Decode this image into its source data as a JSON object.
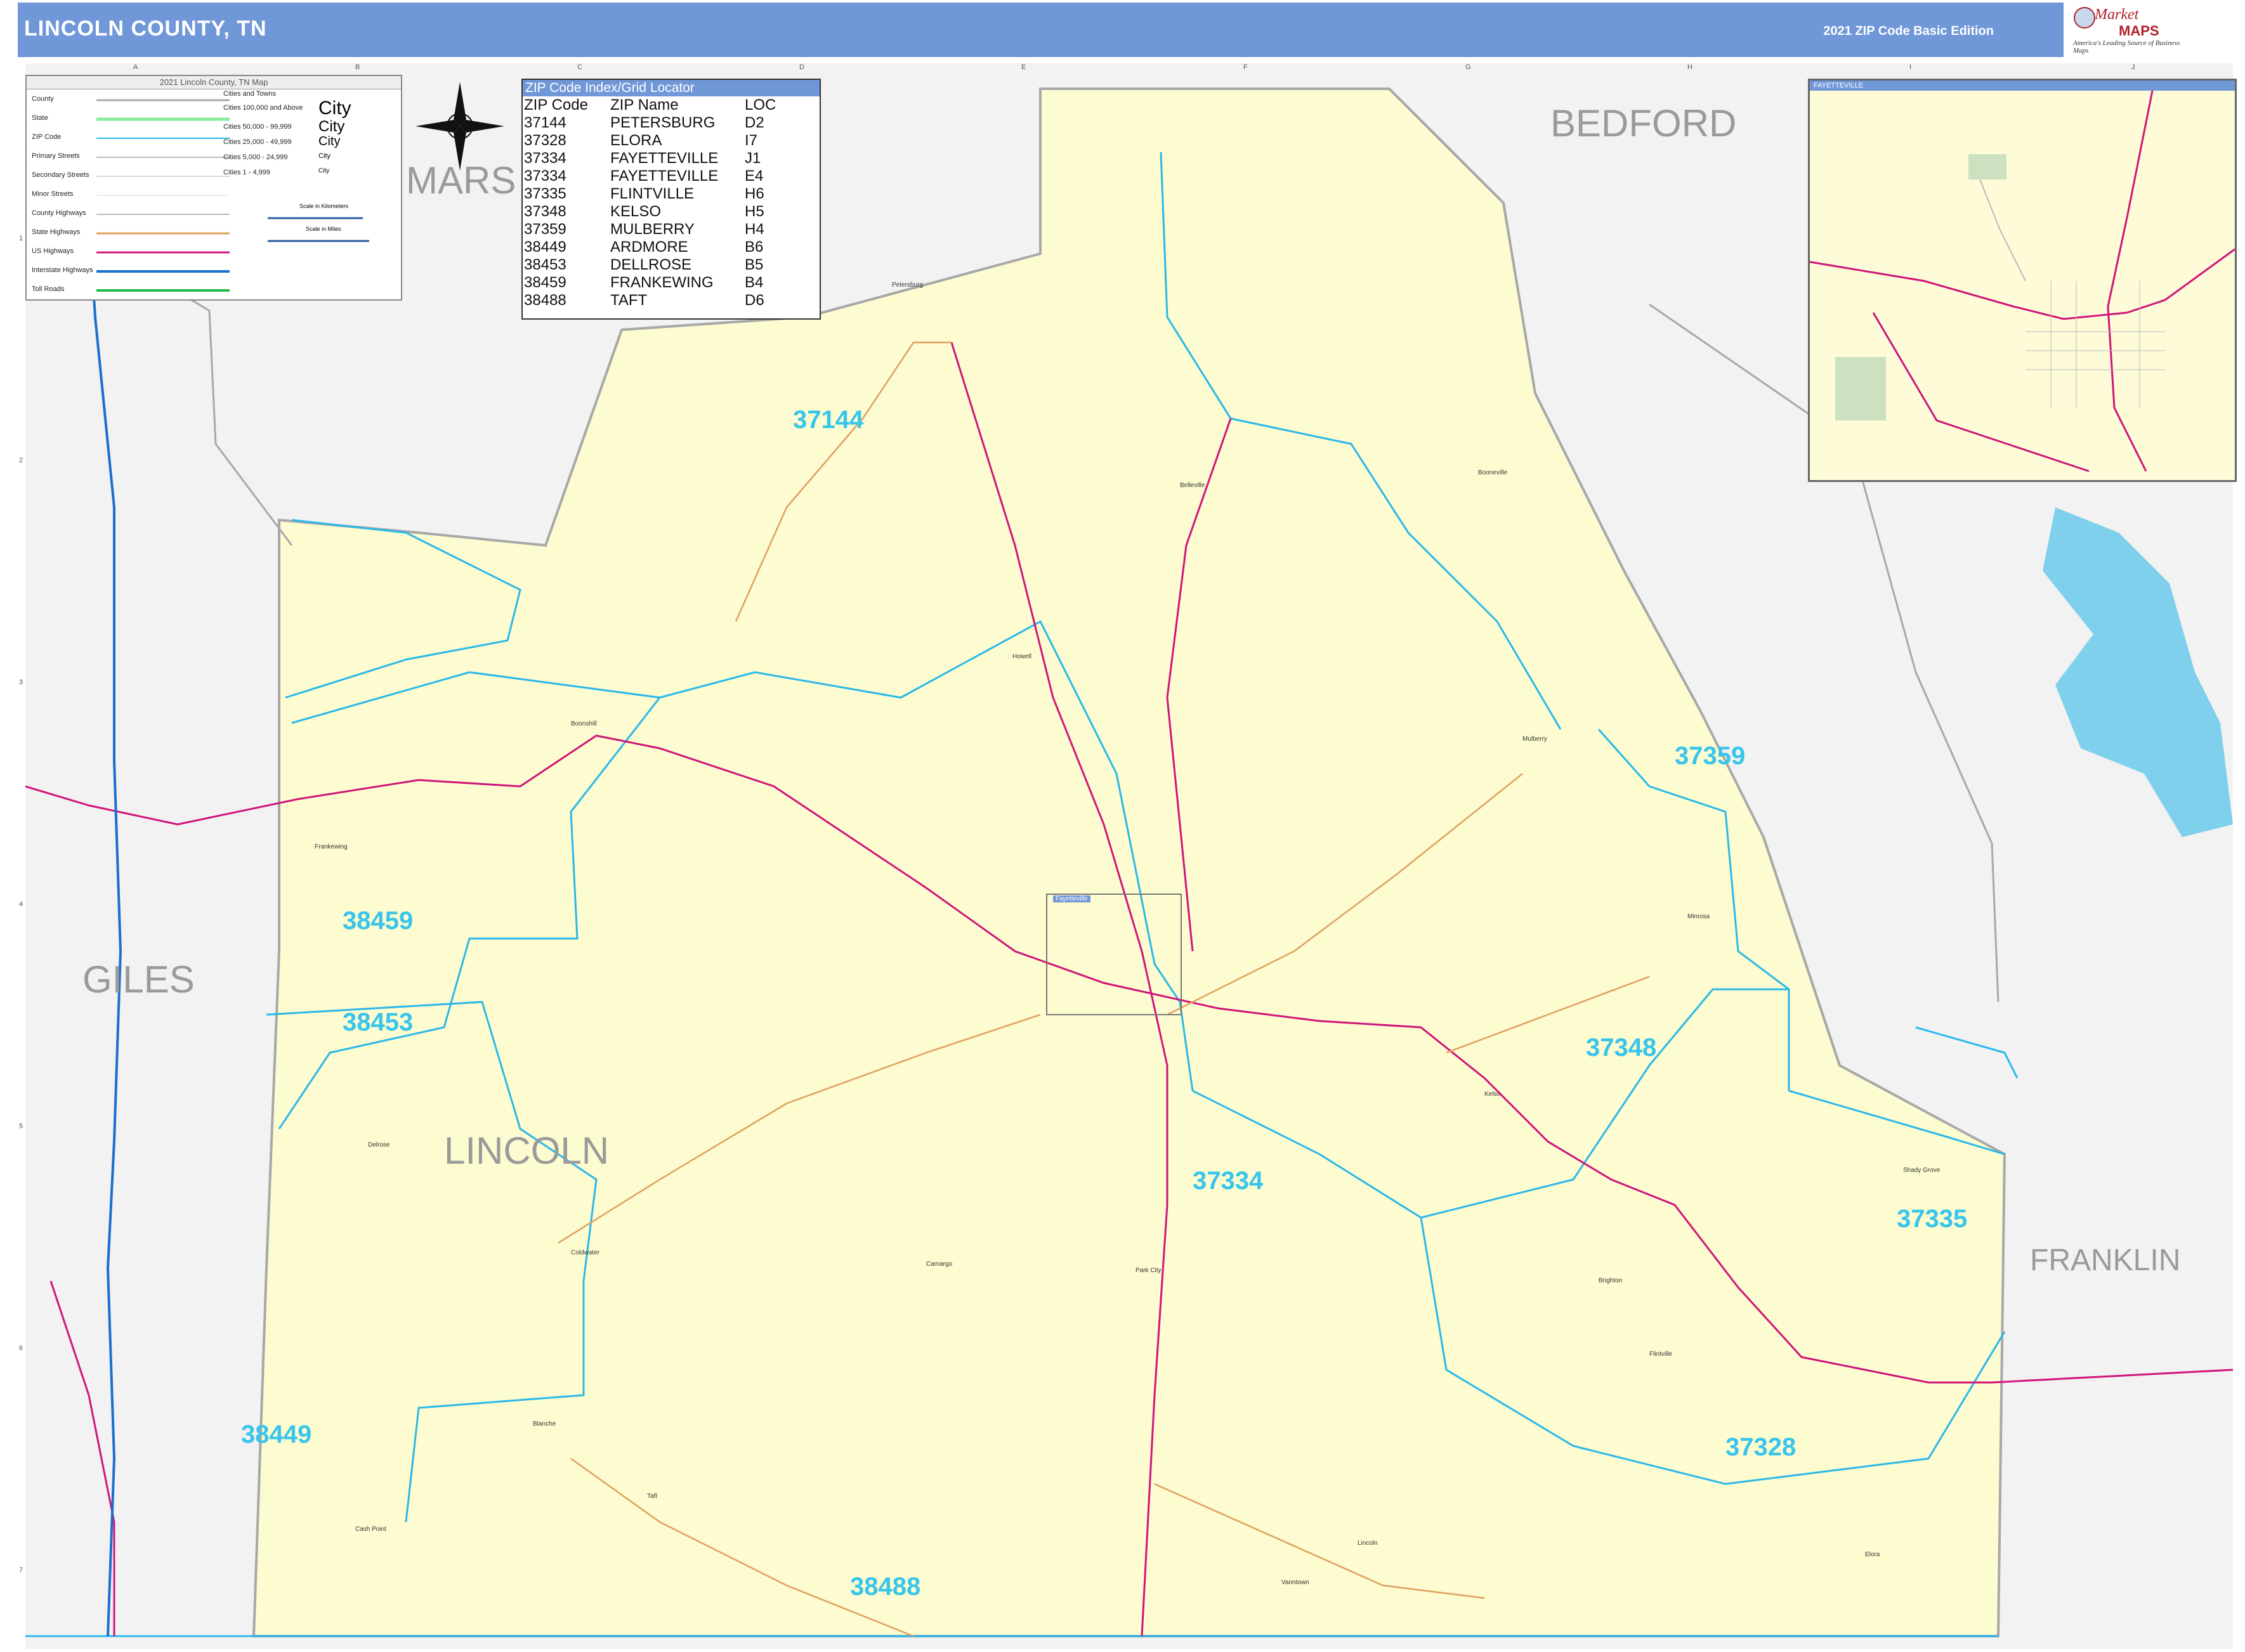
{
  "header": {
    "title": "LINCOLN COUNTY, TN",
    "edition": "2021 ZIP Code Basic Edition",
    "logo_market": "Market",
    "logo_maps": "MAPS",
    "logo_tagline": "America's Leading Source of Business Maps",
    "colors": {
      "bar": "#7097d8",
      "text": "#ffffff"
    }
  },
  "legend": {
    "title": "2021 Lincoln County, TN Map",
    "rows": [
      "County",
      "State",
      "ZIP Code",
      "Primary Streets",
      "Secondary Streets",
      "Minor Streets",
      "County Highways",
      "State Highways",
      "US Highways",
      "Interstate Highways",
      "Toll Roads"
    ],
    "cities_header": "Cities and Towns",
    "city_rows": [
      "Cities 100,000 and Above",
      "Cities 50,000 - 99,999",
      "Cities 25,000 - 49,999",
      "Cities 5,000 - 24,999",
      "Cities 1 - 4,999"
    ],
    "city_samples": [
      "City",
      "City",
      "City",
      "City",
      "City"
    ],
    "scale_km": "Scale in Kilometers",
    "scale_mi": "Scale in Miles"
  },
  "zip_index": {
    "title": "ZIP Code Index/Grid Locator",
    "columns": [
      "ZIP Code",
      "ZIP Name",
      "LOC"
    ],
    "rows": [
      [
        "37144",
        "PETERSBURG",
        "D2"
      ],
      [
        "37328",
        "ELORA",
        "I7"
      ],
      [
        "37334",
        "FAYETTEVILLE",
        "J1"
      ],
      [
        "37334",
        "FAYETTEVILLE",
        "E4"
      ],
      [
        "37335",
        "FLINTVILLE",
        "H6"
      ],
      [
        "37348",
        "KELSO",
        "H5"
      ],
      [
        "37359",
        "MULBERRY",
        "H4"
      ],
      [
        "38449",
        "ARDMORE",
        "B6"
      ],
      [
        "38453",
        "DELLROSE",
        "B5"
      ],
      [
        "38459",
        "FRANKEWING",
        "B4"
      ],
      [
        "38488",
        "TAFT",
        "D6"
      ]
    ]
  },
  "inset": {
    "title": "FAYETTEVILLE"
  },
  "map": {
    "counties": [
      "BEDFORD",
      "MARS",
      "GILES",
      "LINCOLN",
      "FRANKLIN"
    ],
    "zip_labels": [
      "37144",
      "37359",
      "38459",
      "38453",
      "37348",
      "37334",
      "37335",
      "38449",
      "37328",
      "38488"
    ],
    "towns": [
      "Petersburg",
      "Belleville",
      "Booneville",
      "Howell",
      "Boonshill",
      "Mulberry",
      "Fayetteville",
      "Delrose",
      "Kelso",
      "Coldwater",
      "Camargo",
      "Park City",
      "Brighton",
      "Flintville",
      "Blanche",
      "Taft",
      "Cash Point",
      "Lincoln",
      "Vanntown",
      "Elora",
      "Shady Grove",
      "Mimosa",
      "Frankewing"
    ],
    "grid_letters": [
      "A",
      "B",
      "C",
      "D",
      "E",
      "F",
      "G",
      "H",
      "I",
      "J"
    ],
    "grid_numbers": [
      "1",
      "2",
      "3",
      "4",
      "5",
      "6",
      "7"
    ],
    "colors": {
      "county_fill": "#fdfbd0",
      "outside_fill": "#f2f2f2",
      "zip_line": "#2ab9ea",
      "us_highway": "#d0157a",
      "state_highway": "#e0a060",
      "interstate": "#1a6fd0",
      "water": "#7fd0ec",
      "county_border": "#a8a8a8"
    }
  }
}
